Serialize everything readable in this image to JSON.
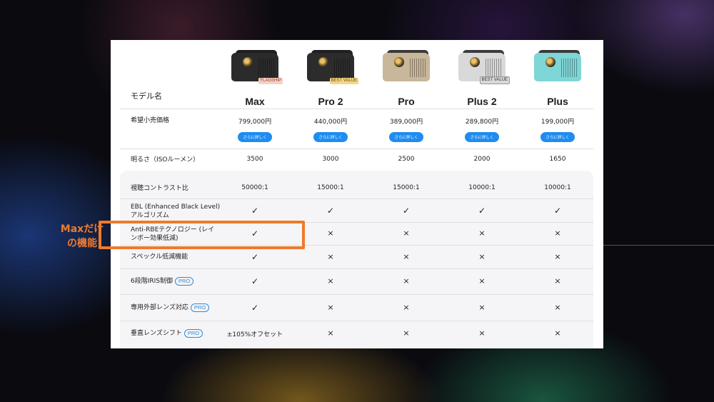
{
  "table": {
    "model_label": "モデル名",
    "models": [
      {
        "name": "Max",
        "badge": "FLAGSHIP",
        "color": "#2b2b2b",
        "top": "#1e1e1e",
        "badge_bg": "#f3d2c8",
        "badge_fg": "#a23a2a"
      },
      {
        "name": "Pro 2",
        "badge": "BEST VALUE",
        "color": "#2c2c2c",
        "top": "#1f1f1f",
        "badge_bg": "#f4d58a",
        "badge_fg": "#6a4a00"
      },
      {
        "name": "Pro",
        "badge": "",
        "color": "#c8b79a",
        "top": "#3a3a3a",
        "badge_bg": "",
        "badge_fg": ""
      },
      {
        "name": "Plus 2",
        "badge": "BEST VALUE",
        "color": "#d9d9d9",
        "top": "#3b3b3b",
        "badge_bg": "#d9d9d9",
        "badge_fg": "#333"
      },
      {
        "name": "Plus",
        "badge": "",
        "color": "#7fd6d6",
        "top": "#3a3a3a",
        "badge_bg": "",
        "badge_fg": ""
      }
    ],
    "price": {
      "label": "希望小売価格",
      "values": [
        "799,000円",
        "440,000円",
        "389,000円",
        "289,800円",
        "199,000円"
      ],
      "button_label": "さらに詳しく"
    },
    "brightness": {
      "label": "明るさ（ISOルーメン）",
      "values": [
        "3500",
        "3000",
        "2500",
        "2000",
        "1650"
      ]
    },
    "contrast": {
      "label": "視聴コントラスト比",
      "values": [
        "50000:1",
        "15000:1",
        "15000:1",
        "10000:1",
        "10000:1"
      ]
    },
    "ebl": {
      "label_line1": "EBL (Enhanced Black Level)",
      "label_line2": "アルゴリズム",
      "values": [
        "✓",
        "✓",
        "✓",
        "✓",
        "✓"
      ]
    },
    "anti_rbe": {
      "label_line1": "Anti-RBEテクノロジー (レイ",
      "label_line2": "ンボー効果低減)",
      "values": [
        "✓",
        "×",
        "×",
        "×",
        "×"
      ]
    },
    "speckle": {
      "label": "スペックル低減機能",
      "values": [
        "✓",
        "×",
        "×",
        "×",
        "×"
      ]
    },
    "iris": {
      "label": "6段階IRIS制御",
      "values": [
        "✓",
        "×",
        "×",
        "×",
        "×"
      ]
    },
    "lens": {
      "label": "専用外部レンズ対応",
      "values": [
        "✓",
        "×",
        "×",
        "×",
        "×"
      ]
    },
    "shift": {
      "label": "垂直レンズシフト",
      "values": [
        "±105%オフセット",
        "×",
        "×",
        "×",
        "×"
      ]
    },
    "pro_tag": "PRO"
  },
  "highlight": {
    "line1": "Maxだけ",
    "line2": "の機能",
    "color": "#ef7a2c"
  }
}
